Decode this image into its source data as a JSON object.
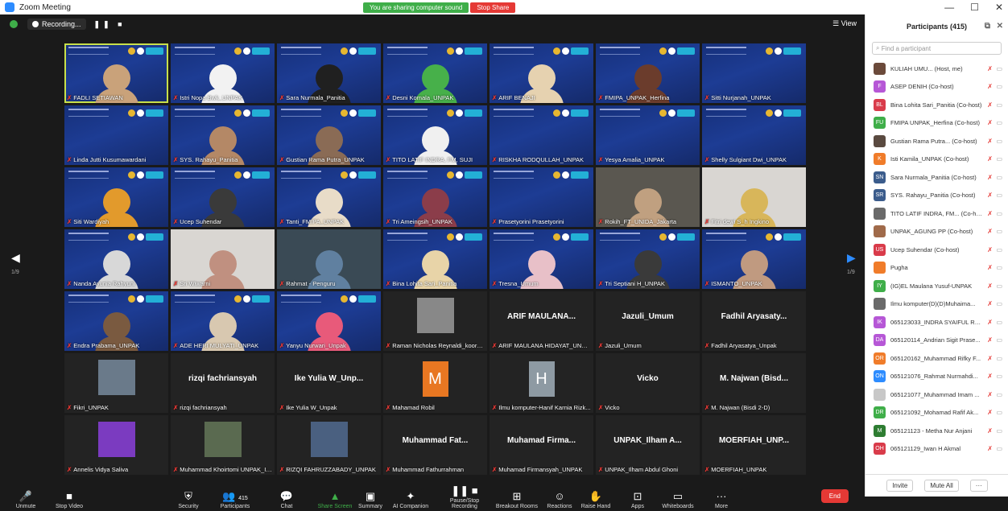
{
  "window": {
    "title": "Zoom Meeting",
    "min": "—",
    "max": "☐",
    "close": "✕"
  },
  "share_banner": {
    "sharing": "You are sharing computer sound",
    "stop": "Stop Share"
  },
  "topbar": {
    "recording": "Recording...",
    "view": "View"
  },
  "tiles": [
    {
      "name": "FADLI SETIAWAN",
      "kind": "slide",
      "active": true,
      "skin": "#c9a27a"
    },
    {
      "name": "Istri Nopa Bwk_UNPAK",
      "kind": "slide",
      "skin": "#f2f2f2"
    },
    {
      "name": "Sara Nurmala_Panitia",
      "kind": "slide",
      "skin": "#202020"
    },
    {
      "name": "Desni Komala_UNPAK",
      "kind": "slide",
      "skin": "#47b04a"
    },
    {
      "name": "ARIF BENAJI",
      "kind": "slide",
      "skin": "#e6d2b0"
    },
    {
      "name": "FMIPA_UNPAK_Herfina",
      "kind": "slide",
      "skin": "#6b3c2c"
    },
    {
      "name": "Sitti Nurjanah_UNPAK",
      "kind": "slide",
      "skin": null
    },
    {
      "name": "Linda Jutti Kusumawardani",
      "kind": "slide",
      "skin": null
    },
    {
      "name": "SYS. Rahayu_Panitia",
      "kind": "slide",
      "skin": "#b48866"
    },
    {
      "name": "Gustian Rama Putra_UNPAK",
      "kind": "slide",
      "skin": "#8a6b55"
    },
    {
      "name": "TITO LATIF INDRA, FM, SUJI",
      "kind": "slide",
      "skin": "#f0f0f0"
    },
    {
      "name": "RISKHA RODQULLAH_UNPAK",
      "kind": "slide",
      "skin": null
    },
    {
      "name": "Yesya Amalia_UNPAK",
      "kind": "slide",
      "skin": null
    },
    {
      "name": "Shelly Sulgiant Dwi_UNPAK",
      "kind": "slide",
      "skin": null
    },
    {
      "name": "Siti Wardiyah",
      "kind": "slide",
      "skin": "#e29a2c"
    },
    {
      "name": "Ucep Suhendar",
      "kind": "slide",
      "skin": "#3a3a3a"
    },
    {
      "name": "Tanti_FMIPA_UNPAK",
      "kind": "slide",
      "skin": "#e8dcc8"
    },
    {
      "name": "Tri Ameingsih_UNPAK",
      "kind": "slide",
      "skin": "#8b3d4a"
    },
    {
      "name": "Prasetyorini Prasetyorini",
      "kind": "slide",
      "skin": null
    },
    {
      "name": "Rokih_FT_UNIDA_Jakarta",
      "kind": "photo",
      "skin": "#c0a080"
    },
    {
      "name": "Fitri dewi S_h Ingkino",
      "kind": "photo2",
      "skin": "#d8b65a"
    },
    {
      "name": "Nanda Ayunia Rahyuni",
      "kind": "slide",
      "skin": "#d8d8d8"
    },
    {
      "name": "Sri Wiwarni",
      "kind": "photo2",
      "skin": "#c09080"
    },
    {
      "name": "Rahmat - Penguru",
      "kind": "photo3",
      "skin": "#6080a0"
    },
    {
      "name": "Bina Lohita Sari_Panitia",
      "kind": "slide",
      "skin": "#e8d4a8"
    },
    {
      "name": "Tresna_Umum",
      "kind": "slide",
      "skin": "#e8c0c8"
    },
    {
      "name": "Tri Septiani H_UNPAK",
      "kind": "slide",
      "skin": "#3a3a3a"
    },
    {
      "name": "ISMANTO_UNPAK",
      "kind": "slide",
      "skin": "#c09a80"
    },
    {
      "name": "Endra Prabama_UNPAK",
      "kind": "slide",
      "skin": "#7a5a40"
    },
    {
      "name": "ADE HERI MULYATI_UNPAK",
      "kind": "slide",
      "skin": "#d8c8b0"
    },
    {
      "name": "Yanyu Nurwari_Unpak",
      "kind": "slide",
      "skin": "#e85a7a"
    },
    {
      "name": "Raman Nicholas Reynaldi_koordi...",
      "kind": "thumb",
      "thumb": "#888"
    },
    {
      "name": "ARIF MAULANA HIDAYAT_UNPAK",
      "kind": "text",
      "big": "ARIF MAULANA..."
    },
    {
      "name": "Jazuli_Umum",
      "kind": "text",
      "big": "Jazuli_Umum"
    },
    {
      "name": "Fadhil Aryasatya_Unpak",
      "kind": "text",
      "big": "Fadhil Aryasaty..."
    },
    {
      "name": "Fikri_UNPAK",
      "kind": "thumb",
      "thumb": "#6a7a8a"
    },
    {
      "name": "rizqi fachriansyah",
      "kind": "text",
      "big": "rizqi fachriansyah"
    },
    {
      "name": "Ike Yulia W_Unpak",
      "kind": "text",
      "big": "Ike Yulia W_Unp..."
    },
    {
      "name": "Mahamad Robil",
      "kind": "avatar",
      "letter": "M",
      "color": "#e87722"
    },
    {
      "name": "Ilmu komputer-Hanif Karnia Rizk...",
      "kind": "avatar",
      "letter": "H",
      "color": "#8e9aa3"
    },
    {
      "name": "Vicko",
      "kind": "text",
      "big": "Vicko"
    },
    {
      "name": "M. Najwan (Bisdi 2-D)",
      "kind": "text",
      "big": "M. Najwan (Bisd..."
    },
    {
      "name": "Annelis Vidya Saliva",
      "kind": "thumb",
      "thumb": "#7b3bc0"
    },
    {
      "name": "Muhammad Khoirtomi UNPAK_ICE...",
      "kind": "thumb",
      "thumb": "#5a6a50"
    },
    {
      "name": "RIZQI FAHRUZZABADY_UNPAK",
      "kind": "thumb",
      "thumb": "#4a6080"
    },
    {
      "name": "Muhammad Fathurrahman",
      "kind": "text",
      "big": "Muhammad Fat..."
    },
    {
      "name": "Muhamad Firmansyah_UNPAK",
      "kind": "text",
      "big": "Muhamad Firma..."
    },
    {
      "name": "UNPAK_Ilham Abdul Ghoni",
      "kind": "text",
      "big": "UNPAK_Ilham A..."
    },
    {
      "name": "MOERFIAH_UNPAK",
      "kind": "text",
      "big": "MOERFIAH_UNP..."
    }
  ],
  "nav": {
    "left": "◀",
    "left_page": "1/9",
    "right": "▶",
    "right_page": "1/9"
  },
  "toolbar": {
    "unmute": "Unmute",
    "stop_video": "Stop Video",
    "security": "Security",
    "participants": "Participants",
    "participants_count": "415",
    "chat": "Chat",
    "share": "Share Screen",
    "summary": "Summary",
    "companion": "AI Companion",
    "recording": "Pause/Stop Recording",
    "breakout": "Breakout Rooms",
    "reactions": "Reactions",
    "raise": "Raise Hand",
    "apps": "Apps",
    "whiteboards": "Whiteboards",
    "more": "More",
    "end": "End"
  },
  "panel": {
    "title": "Participants (415)",
    "search_placeholder": "Find a participant",
    "invite": "Invite",
    "mute_all": "Mute All",
    "more": "···",
    "participants": [
      {
        "avatar": "",
        "color": "#6b4a3a",
        "name": "KULIAH UMU... (Host, me)"
      },
      {
        "avatar": "F",
        "color": "#b657d6",
        "name": "ASEP DENIH (Co-host)"
      },
      {
        "avatar": "BL",
        "color": "#d93b4a",
        "name": "Bina Lohita Sari_Panitia (Co-host)"
      },
      {
        "avatar": "FU",
        "color": "#3fae49",
        "name": "FMIPA UNPAK_Herfina (Co-host)"
      },
      {
        "avatar": "",
        "color": "#5a4a40",
        "name": "Gustian Rama Putra... (Co-host)"
      },
      {
        "avatar": "K",
        "color": "#f07c2a",
        "name": "Isti Kamila_UNPAK (Co-host)"
      },
      {
        "avatar": "SN",
        "color": "#3b5c8c",
        "name": "Sara Nurmala_Panitia (Co-host)"
      },
      {
        "avatar": "SR",
        "color": "#3b5c8c",
        "name": "SYS. Rahayu_Panitia (Co-host)"
      },
      {
        "avatar": "",
        "color": "#6a6a6a",
        "name": "TITO LATIF INDRA, FM... (Co-host)"
      },
      {
        "avatar": "",
        "color": "#a06a4a",
        "name": "UNPAK_AGUNG PP (Co-host)"
      },
      {
        "avatar": "US",
        "color": "#d93b4a",
        "name": "Ucep Suhendar (Co-host)"
      },
      {
        "avatar": "",
        "color": "#f07c2a",
        "name": "Pugha"
      },
      {
        "avatar": "IY",
        "color": "#3fae49",
        "name": "(IG)EL Maulana Yusuf-UNPAK"
      },
      {
        "avatar": "",
        "color": "#6a6a6a",
        "name": "Ilmu komputer(D)(D)Muhaima..."
      },
      {
        "avatar": "IK",
        "color": "#b657d6",
        "name": "065123033_INDRA SYAIFUL RO..."
      },
      {
        "avatar": "DA",
        "color": "#b657d6",
        "name": "065120114_Andrian Sigit Prase..."
      },
      {
        "avatar": "OR",
        "color": "#f07c2a",
        "name": "065120162_Muhammad Rifky F..."
      },
      {
        "avatar": "ON",
        "color": "#2d8cff",
        "name": "065121076_Rahmat Nurmahdi..."
      },
      {
        "avatar": "",
        "color": "#c8c8c8",
        "name": "065121077_Muhammad Imam ..."
      },
      {
        "avatar": "DR",
        "color": "#3fae49",
        "name": "065121092_Mohamad Rafif Ak..."
      },
      {
        "avatar": "M",
        "color": "#2e7d32",
        "name": "065121123 - Metha Nur Anjani"
      },
      {
        "avatar": "OH",
        "color": "#d93b4a",
        "name": "065121129_Iwan H Akmal"
      }
    ]
  }
}
